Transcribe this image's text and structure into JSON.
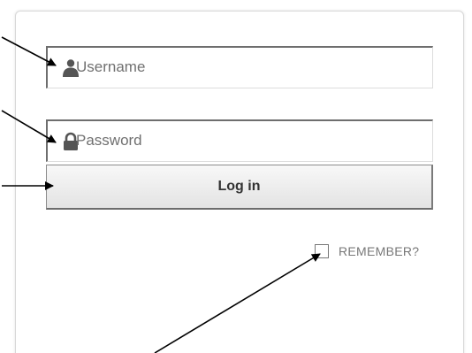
{
  "login_form": {
    "username_placeholder": "Username",
    "username_icon": "user-icon",
    "password_placeholder": "Password",
    "password_icon": "lock-icon",
    "login_button_label": "Log in",
    "remember_label": "REMEMBER?",
    "remember_checked": false
  },
  "annotations": {
    "arrow_count": 4,
    "arrow_color": "#000000"
  },
  "colors": {
    "field_text": "#707070",
    "button_text": "#333333",
    "icon": "#555555"
  }
}
